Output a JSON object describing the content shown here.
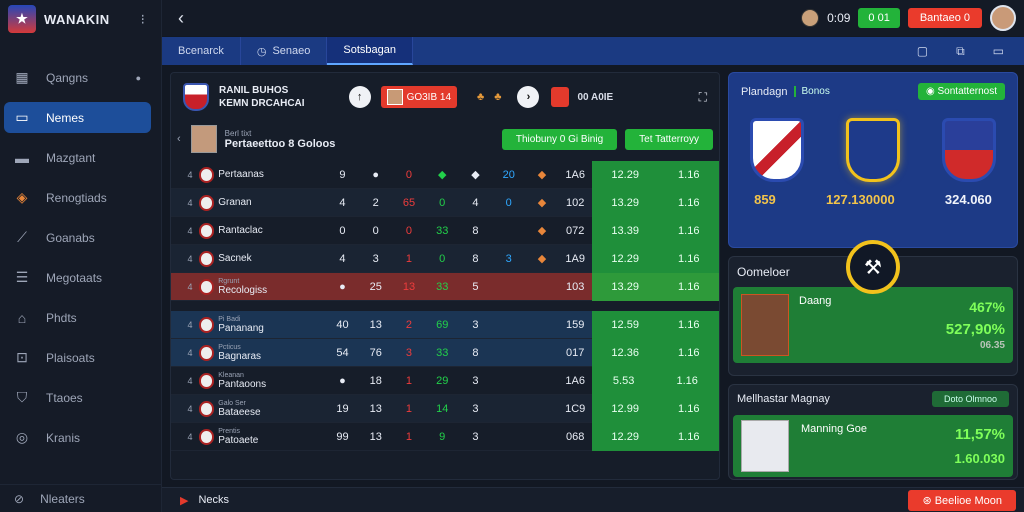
{
  "app": {
    "name": "WANAKIN"
  },
  "sidebar": {
    "items": [
      {
        "label": "Qangns",
        "icon": "grid-icon"
      },
      {
        "label": "Nemes",
        "icon": "folder-icon"
      },
      {
        "label": "Mazgtant",
        "icon": "chat-icon"
      },
      {
        "label": "Renogtiads",
        "icon": "shield-icon"
      },
      {
        "label": "Goanabs",
        "icon": "wand-icon"
      },
      {
        "label": "Megotaats",
        "icon": "document-icon"
      },
      {
        "label": "Phdts",
        "icon": "home-icon"
      },
      {
        "label": "Plaisoats",
        "icon": "tag-icon"
      },
      {
        "label": "Ttaoes",
        "icon": "badge-icon"
      },
      {
        "label": "Kranis",
        "icon": "globe-icon"
      }
    ],
    "footer": "Nleaters"
  },
  "topbar": {
    "score": "0:09",
    "green_btn": "0 01",
    "red_btn": "Bantaeo 0"
  },
  "tabs": [
    {
      "label": "Bcenarck"
    },
    {
      "label": "Senaeo"
    },
    {
      "label": "Sotsbagan"
    }
  ],
  "match": {
    "team_line1": "RANIL BUHOS",
    "team_line2": "KEMN DRCAHCAI",
    "score_chip": "GO3IB 14",
    "score_right": "00 A0IE",
    "player_role": "Berl tixt",
    "player_name": "Pertaeettoo 8 Goloos",
    "btn1": "Thiobuny 0",
    "btn2": "Gi Binig",
    "btn3": "Tet Tatterroyy"
  },
  "rows": [
    {
      "n": "4",
      "name": "Pertaanas",
      "sub": "",
      "c1": "9",
      "c2": "●",
      "c3": "0",
      "c4": "◆",
      "c5": "◆",
      "c6": "20",
      "c7": "◆",
      "c8": "1A6",
      "v1": "12.29",
      "v2": "1.16"
    },
    {
      "n": "4",
      "name": "Granan",
      "sub": "",
      "c1": "4",
      "c2": "2",
      "c3": "65",
      "c4": "0",
      "c5": "4",
      "c6": "0",
      "c7": "◆",
      "c8": "102",
      "v1": "13.29",
      "v2": "1.16"
    },
    {
      "n": "4",
      "name": "Rantaclac",
      "sub": "",
      "c1": "0",
      "c2": "0",
      "c3": "0",
      "c4": "33",
      "c5": "8",
      "c6": "",
      "c7": "◆",
      "c8": "072",
      "v1": "13.39",
      "v2": "1.16"
    },
    {
      "n": "4",
      "name": "Sacnek",
      "sub": "",
      "c1": "4",
      "c2": "3",
      "c3": "1",
      "c4": "0",
      "c5": "8",
      "c6": "3",
      "c7": "◆",
      "c8": "1A9",
      "v1": "12.29",
      "v2": "1.16"
    },
    {
      "n": "4",
      "name": "Recologiss",
      "sub": "Rgrunt",
      "c1": "●",
      "c2": "25",
      "c3": "13",
      "c4": "33",
      "c5": "5",
      "c6": "",
      "c7": "",
      "c8": "103",
      "v1": "13.29",
      "v2": "1.16"
    },
    {
      "n": "4",
      "name": "Pananang",
      "sub": "Pi Badi",
      "c1": "40",
      "c2": "13",
      "c3": "2",
      "c4": "69",
      "c5": "3",
      "c6": "",
      "c7": "",
      "c8": "159",
      "v1": "12.59",
      "v2": "1.16"
    },
    {
      "n": "4",
      "name": "Bagnaras",
      "sub": "Pcticus",
      "c1": "54",
      "c2": "76",
      "c3": "3",
      "c4": "33",
      "c5": "8",
      "c6": "",
      "c7": "",
      "c8": "017",
      "v1": "12.36",
      "v2": "1.16"
    },
    {
      "n": "4",
      "name": "Pantaoons",
      "sub": "Kleanan",
      "c1": "●",
      "c2": "18",
      "c3": "1",
      "c4": "29",
      "c5": "3",
      "c6": "",
      "c7": "",
      "c8": "1A6",
      "v1": "5.53",
      "v2": "1.16"
    },
    {
      "n": "4",
      "name": "Bataeese",
      "sub": "Galo Ser",
      "c1": "19",
      "c2": "13",
      "c3": "1",
      "c4": "14",
      "c5": "3",
      "c6": "",
      "c7": "",
      "c8": "1C9",
      "v1": "12.99",
      "v2": "1.16"
    },
    {
      "n": "4",
      "name": "Patoaete",
      "sub": "Prentis",
      "c1": "99",
      "c2": "13",
      "c3": "1",
      "c4": "9",
      "c5": "3",
      "c6": "",
      "c7": "",
      "c8": "068",
      "v1": "12.29",
      "v2": "1.16"
    }
  ],
  "right": {
    "card_title": "Plandagn",
    "card_tag": "Bonos",
    "card_btn": "Sontatternost",
    "vals": [
      "859",
      "127.130000",
      "324.060"
    ],
    "mid_title": "Oomeloer",
    "mid_name": "Daang",
    "mid_v1": "467%",
    "mid_v2": "527,90%",
    "mid_v3": "06.35",
    "bot_title": "Mellhastar Magnay",
    "bot_chip": "Doto Olmnoo",
    "bot_name": "Manning Goe",
    "bot_v1": "11,57%",
    "bot_v2": "1.60.030"
  },
  "bottom": {
    "label": "Necks",
    "button": "Beelioe Moon"
  }
}
